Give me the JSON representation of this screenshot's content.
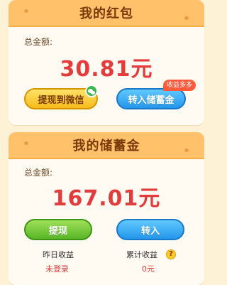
{
  "red_envelope": {
    "title": "我的红包",
    "total_label": "总金额:",
    "amount": "30.81元",
    "withdraw_wechat_label": "提现到微信",
    "transfer_savings_label": "转入储蓄金",
    "bonus_tag": "收益多多"
  },
  "savings": {
    "title": "我的储蓄金",
    "total_label": "总金额:",
    "amount": "167.01元",
    "withdraw_label": "提现",
    "transfer_in_label": "转入",
    "yesterday_label": "昨日收益",
    "yesterday_value": "未登录",
    "cumulative_label": "累计收益",
    "cumulative_value": "0元"
  },
  "icons": {
    "wechat": "wechat-icon",
    "help": "help-icon"
  },
  "colors": {
    "background": "#fdf1d6",
    "header": "#ffc26a",
    "amount": "#e23c3c",
    "yellow_button": "#f8bb1a",
    "blue_button": "#2496ea",
    "green_button": "#58b626"
  }
}
